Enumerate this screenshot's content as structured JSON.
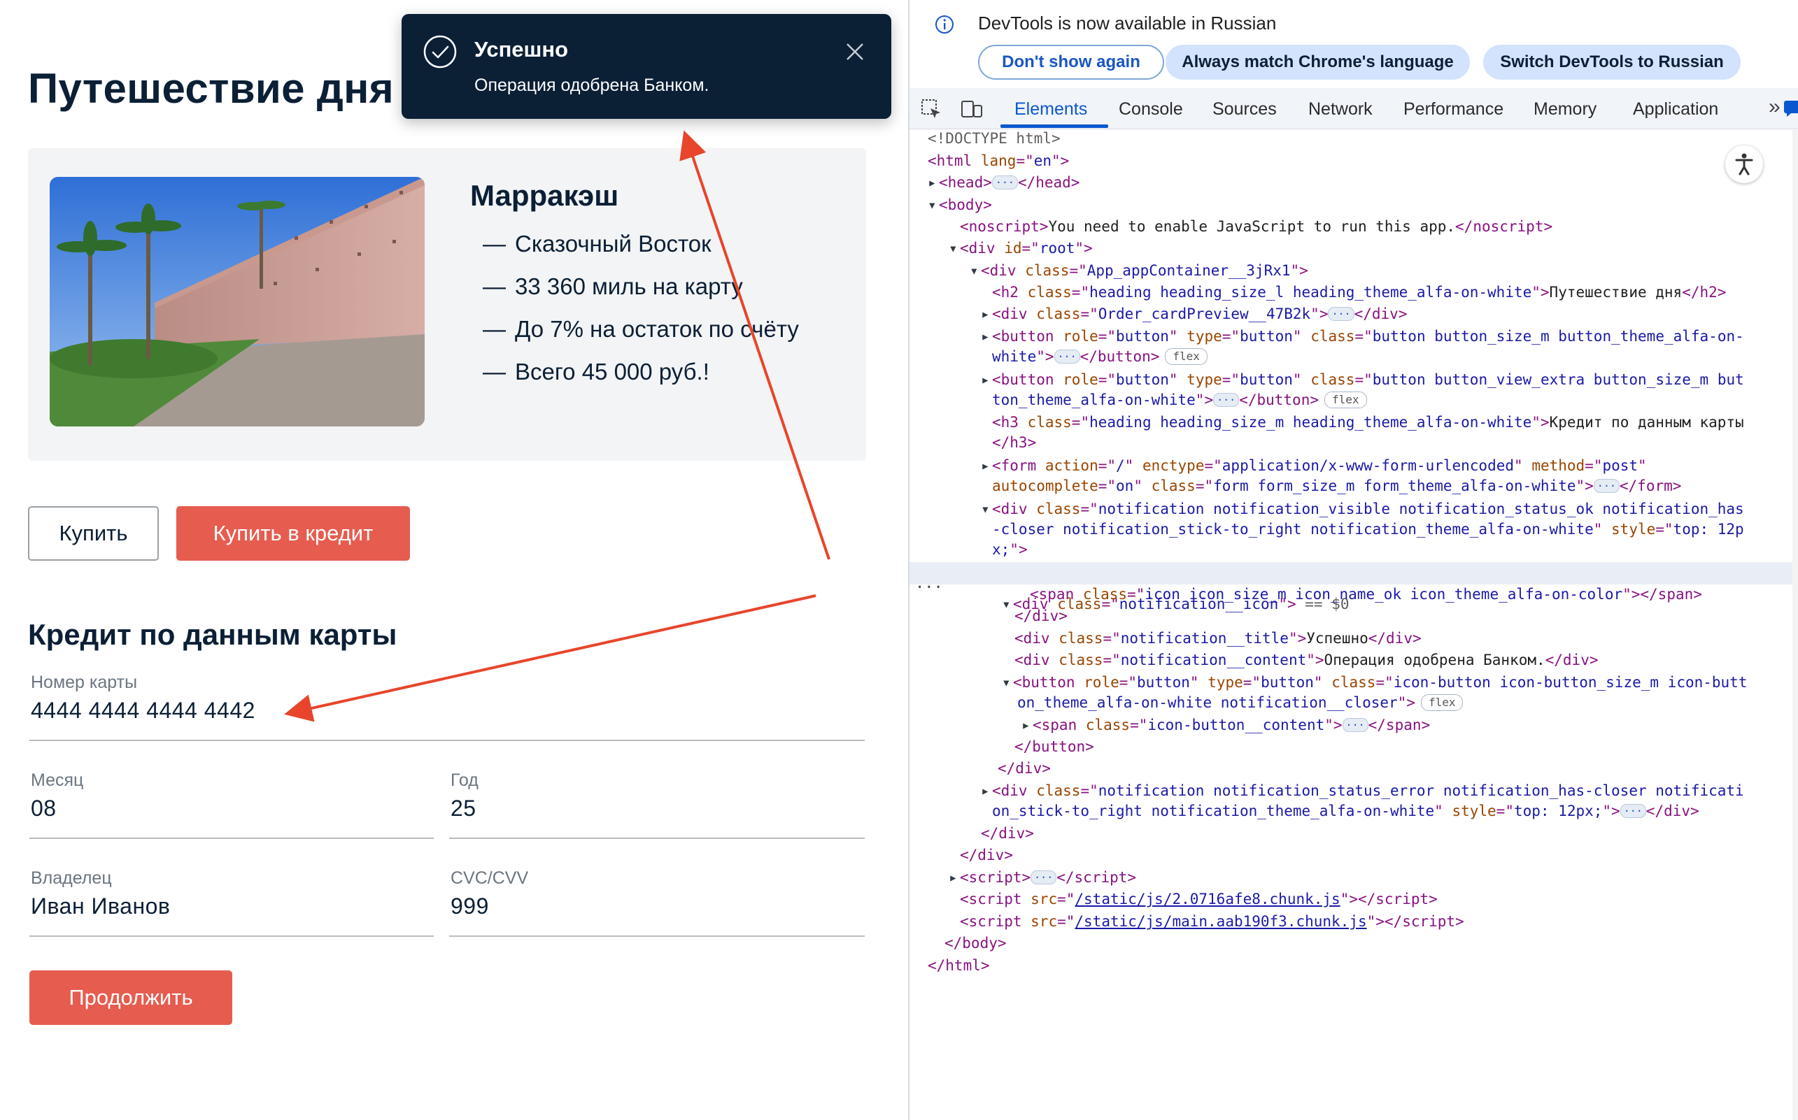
{
  "app": {
    "page_title": "Путешествие дня",
    "card": {
      "city": "Марракэш",
      "features": [
        "Сказочный Восток",
        "33 360 миль на карту",
        "До 7% на остаток по счёту",
        "Всего 45 000 руб.!"
      ],
      "dash": "—"
    },
    "buttons": {
      "buy": "Купить",
      "buy_credit": "Купить в кредит",
      "continue": "Продолжить"
    },
    "credit_heading": "Кредит по данным карты",
    "form": {
      "card_number": {
        "label": "Номер карты",
        "value": "4444 4444 4444 4442"
      },
      "month": {
        "label": "Месяц",
        "value": "08"
      },
      "year": {
        "label": "Год",
        "value": "25"
      },
      "owner": {
        "label": "Владелец",
        "value": "Иван Иванов"
      },
      "cvc": {
        "label": "CVC/CVV",
        "value": "999"
      }
    },
    "notification": {
      "title": "Успешно",
      "content": "Операция одобрена Банком.",
      "icon": "check-circle-icon"
    },
    "colors": {
      "accent": "#e65c4f",
      "dark": "#0b1f35",
      "annotation": "#e8452c"
    }
  },
  "devtools": {
    "infobar": {
      "text": "DevTools is now available in Russian",
      "dont_show": "Don't show again",
      "match_language": "Always match Chrome's language",
      "switch": "Switch DevTools to Russian"
    },
    "tabs": [
      "Elements",
      "Console",
      "Sources",
      "Network",
      "Performance",
      "Memory",
      "Application"
    ],
    "active_tab": "Elements",
    "more": "»",
    "code": {
      "doctype": "<!DOCTYPE html>",
      "noscript_text": "You need to enable JavaScript to run this app.",
      "h2_class": "heading heading_size_l heading_theme_alfa-on-white",
      "h2_text": "Путешествие дня",
      "card_class": "Order_cardPreview__47B2k",
      "btn1_class_a": "button button_size_m button_theme_alfa-on-",
      "btn1_class_b": "white",
      "btn2_class_a": "button button_view_extra button_size_m but",
      "btn2_class_b": "ton_theme_alfa-on-white",
      "h3_class": "heading heading_size_m heading_theme_alfa-on-white",
      "h3_text_a": "Кредит по данным карты",
      "form_action": "/",
      "form_enctype": "application/x-www-form-urlencoded",
      "form_method": "post",
      "form_autocomplete": "on",
      "form_class": "form form_size_m form_theme_alfa-on-white",
      "notif_class_a": "notification notification_visible notification_status_ok notification_has",
      "notif_class_b": "-closer notification_stick-to_right notification_theme_alfa-on-white",
      "notif_style_a": "top: 12p",
      "notif_style_b": "x;",
      "icon_div_class": "notification__icon",
      "selected_marker": "== $0",
      "span_class": "icon icon_size_m icon_name_ok icon_theme_alfa-on-color",
      "title_class": "notification__title",
      "title_text": "Успешно",
      "content_class": "notification__content",
      "content_text": "Операция одобрена Банком.",
      "closer_class_a": "icon-button icon-button_size_m icon-butt",
      "closer_class_b": "on_theme_alfa-on-white notification__closer",
      "closer_span_class": "icon-button__content",
      "notif2_class_a": "notification notification_status_error notification_has-closer notificati",
      "notif2_class_b": "on_stick-to_right notification_theme_alfa-on-white",
      "notif2_style": "top: 12px;",
      "script1_src": "/static/js/2.0716afe8.chunk.js",
      "script2_src": "/static/js/main.aab190f3.chunk.js",
      "flex": "flex"
    }
  }
}
